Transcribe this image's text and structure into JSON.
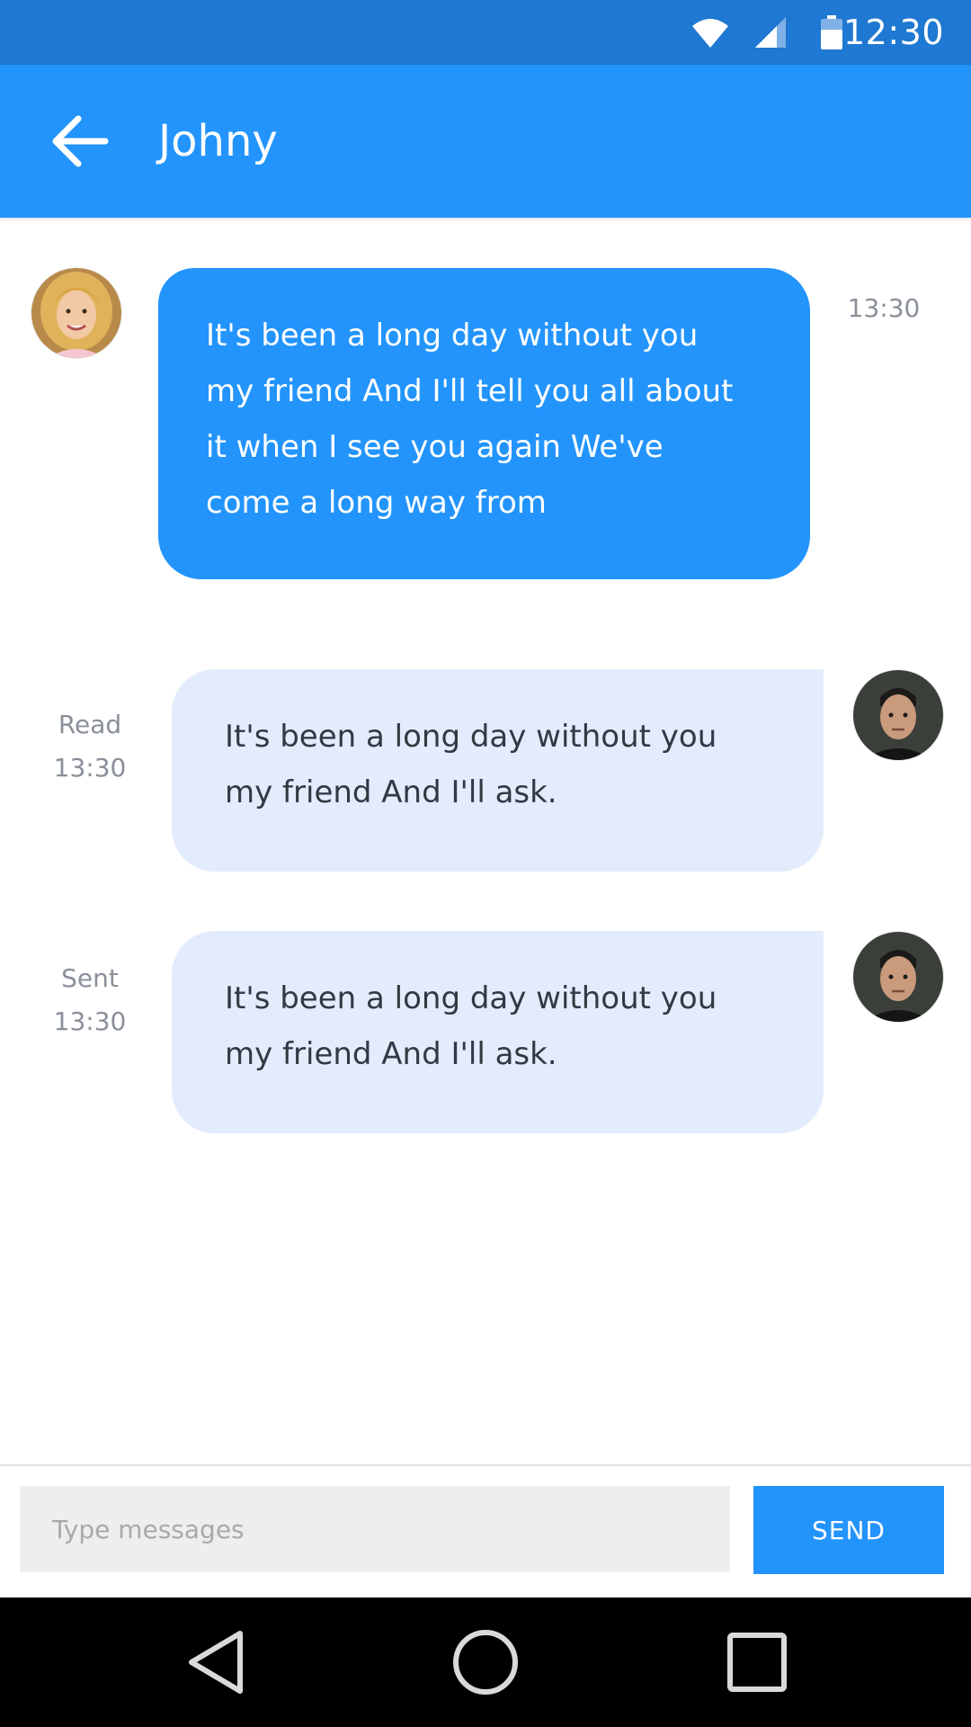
{
  "status_bar": {
    "time": "12:30",
    "icons": [
      "wifi-icon",
      "cell-signal-icon",
      "battery-icon"
    ]
  },
  "app_bar": {
    "title": "Johny",
    "back_icon": "back-arrow-icon"
  },
  "messages": [
    {
      "direction": "incoming",
      "text": "It's been a long day without you my friend And I'll tell you all about it when I see you again We've come a long way from",
      "lines": [
        "It's been a long day without you",
        "my friend And I'll tell you all about",
        "it when I see you again We've",
        "come a long way from"
      ],
      "status": "",
      "time": "13:30",
      "avatar": "woman-avatar"
    },
    {
      "direction": "outgoing",
      "text": "It's been a long day without you my friend And I'll ask.",
      "lines": [
        "It's been a long day without you",
        "my friend And I'll ask."
      ],
      "status": "Read",
      "time": "13:30",
      "avatar": "man-avatar"
    },
    {
      "direction": "outgoing",
      "text": "It's been a long day without you my friend And I'll ask.",
      "lines": [
        "It's been a long day without you",
        "my friend And I'll ask."
      ],
      "status": "Sent",
      "time": "13:30",
      "avatar": "man-avatar"
    }
  ],
  "composer": {
    "placeholder": "Type messages",
    "value": "",
    "send_label": "SEND"
  },
  "nav_bar": {
    "buttons": [
      "back-triangle-icon",
      "home-circle-icon",
      "recents-square-icon"
    ]
  },
  "colors": {
    "status_bar": "#1f78d1",
    "primary": "#2394fc",
    "outgoing_bubble": "#e2ecfd",
    "outgoing_text": "#333842",
    "meta_text": "#8a9099",
    "input_bg": "#eeeeee",
    "nav_bar": "#000000"
  }
}
